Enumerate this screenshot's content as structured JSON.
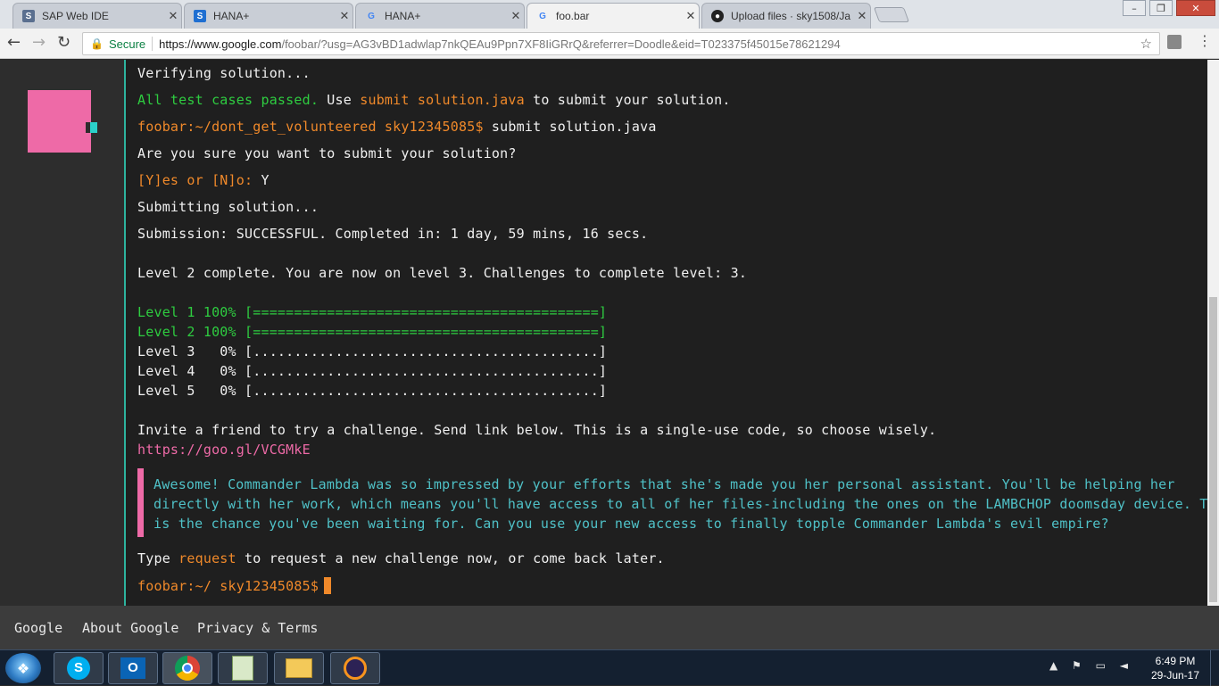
{
  "tabs": [
    {
      "title": "SAP Web IDE",
      "icon": "sap-icon"
    },
    {
      "title": "HANA+",
      "icon": "sap-icon"
    },
    {
      "title": "HANA+",
      "icon": "google-icon"
    },
    {
      "title": "foo.bar",
      "icon": "google-icon"
    },
    {
      "title": "Upload files · sky1508/Ja",
      "icon": "github-icon"
    }
  ],
  "window": {
    "minimize": "–",
    "maximize": "❐",
    "close": "✕"
  },
  "toolbar": {
    "back": "←",
    "forward": "→",
    "reload": "↻",
    "secure": "Secure",
    "url_host": "https://www.google.com",
    "url_rest": "/foobar/?usg=AG3vBD1adwlap7nkQEAu9Ppn7XF8IiGRrQ&referrer=Doodle&eid=T023375f45015e78621294",
    "star": "☆",
    "menu": "⋮"
  },
  "terminal": {
    "verifying": "Verifying solution...",
    "passed": "All test cases passed.",
    "use": " Use ",
    "submit_cmd": "submit solution.java",
    "to_submit": " to submit your solution.",
    "prompt1": "foobar:~/dont_get_volunteered sky12345085$",
    "cmd1": " submit solution.java",
    "are_you_sure": "Are you sure you want to submit your solution?",
    "yn": "[Y]es or [N]o:",
    "yn_answer": " Y",
    "submitting": "Submitting solution...",
    "submission": "Submission: SUCCESSFUL. Completed in: 1 day, 59 mins, 16 secs.",
    "level_complete": "Level 2 complete. You are now on level 3. Challenges to complete level: 3.",
    "levels": [
      "Level 1 100% [==========================================]",
      "Level 2 100% [==========================================]",
      "Level 3   0% [..........................................]",
      "Level 4   0% [..........................................]",
      "Level 5   0% [..........................................]"
    ],
    "invite": "Invite a friend to try a challenge. Send link below. This is a single-use code, so choose wisely.",
    "link": "https://goo.gl/VCGMkE",
    "quote_lines": [
      "Awesome! Commander Lambda was so impressed by your efforts that she's made you her personal assistant. You'll be helping her",
      "directly with her work, which means you'll have access to all of her files-including the ones on the LAMBCHOP doomsday device. This",
      "is the chance you've been waiting for. Can you use your new access to finally topple Commander Lambda's evil empire?"
    ],
    "type": "Type ",
    "request": "request",
    "type_rest": " to request a new challenge now, or come back later.",
    "prompt2": "foobar:~/ sky12345085$"
  },
  "footer": {
    "google": "Google",
    "about": "About Google",
    "privacy": "Privacy & Terms"
  },
  "taskbar": {
    "time": "6:49 PM",
    "date": "29-Jun-17",
    "tray_icons": "▲ ⚑ ▭ ◄"
  }
}
